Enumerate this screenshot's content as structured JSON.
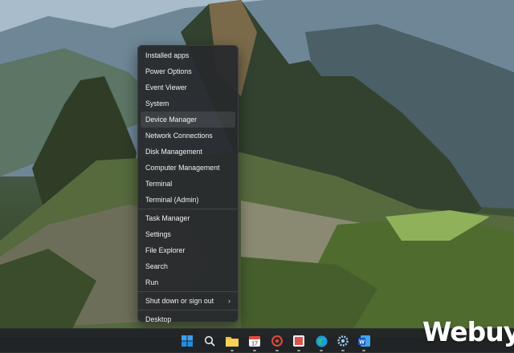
{
  "menu": {
    "items": [
      {
        "label": "Installed apps"
      },
      {
        "label": "Power Options"
      },
      {
        "label": "Event Viewer"
      },
      {
        "label": "System"
      },
      {
        "label": "Device Manager"
      },
      {
        "label": "Network Connections"
      },
      {
        "label": "Disk Management"
      },
      {
        "label": "Computer Management"
      },
      {
        "label": "Terminal"
      },
      {
        "label": "Terminal (Admin)"
      },
      {
        "label": "Task Manager"
      },
      {
        "label": "Settings"
      },
      {
        "label": "File Explorer"
      },
      {
        "label": "Search"
      },
      {
        "label": "Run"
      },
      {
        "label": "Shut down or sign out"
      },
      {
        "label": "Desktop"
      }
    ],
    "highlighted_item": "Device Manager",
    "submenu_arrow": "›"
  },
  "taskbar": {
    "icons": [
      "windows-start-icon",
      "search-icon",
      "file-explorer-icon",
      "calendar-icon",
      "media-icon",
      "photos-icon",
      "edge-browser-icon",
      "settings-icon",
      "word-icon"
    ]
  },
  "watermark": {
    "text": "Webuy"
  },
  "colors": {
    "menu_bg": "#27292d",
    "taskbar_bg": "#202226",
    "windows_blue": "#1e8fe0"
  }
}
